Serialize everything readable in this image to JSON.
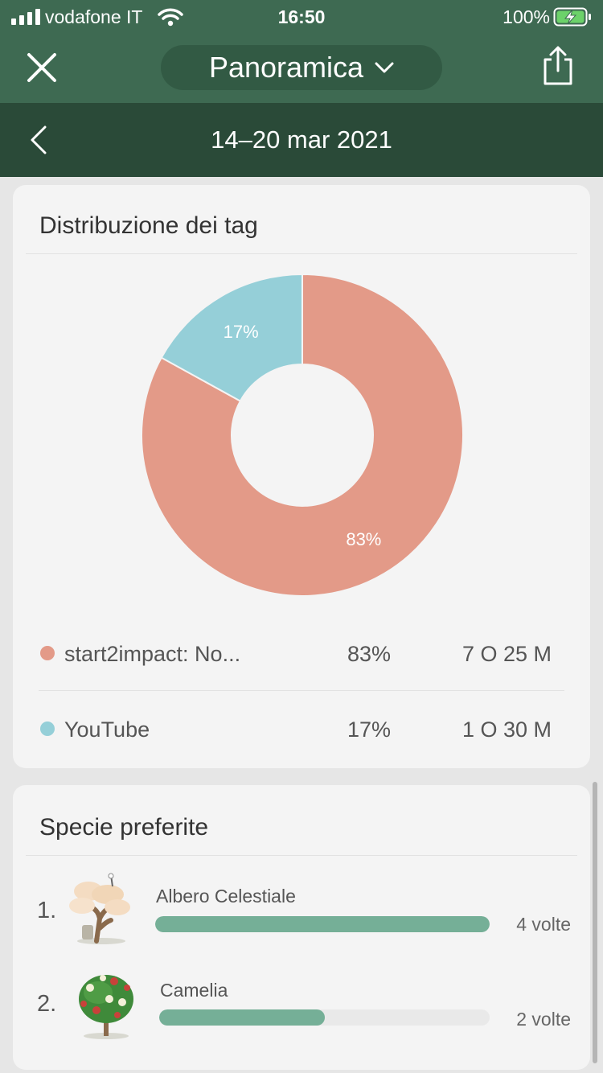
{
  "status_bar": {
    "carrier": "vodafone IT",
    "time": "16:50",
    "battery": "100%"
  },
  "header": {
    "title": "Panoramica"
  },
  "date_range": "14–20 mar 2021",
  "tag_distribution": {
    "title": "Distribuzione dei tag",
    "items": [
      {
        "name": "start2impact: No...",
        "percent": "83%",
        "duration": "7 O 25 M",
        "color": "#e39a88"
      },
      {
        "name": "YouTube",
        "percent": "17%",
        "duration": "1 O 30 M",
        "color": "#95cfd8"
      }
    ]
  },
  "chart_data": {
    "type": "pie",
    "categories": [
      "start2impact: No...",
      "YouTube"
    ],
    "values": [
      83,
      17
    ],
    "labels": [
      "83%",
      "17%"
    ],
    "colors": [
      "#e39a88",
      "#95cfd8"
    ]
  },
  "favorite_species": {
    "title": "Specie preferite",
    "items": [
      {
        "rank": "1.",
        "name": "Albero Celestiale",
        "count": "4 volte",
        "fraction": 1.0
      },
      {
        "rank": "2.",
        "name": "Camelia",
        "count": "2 volte",
        "fraction": 0.5
      }
    ]
  },
  "colors": {
    "topbar": "#3e6a52",
    "datebar": "#2a4a38",
    "accent": "#75af97"
  }
}
